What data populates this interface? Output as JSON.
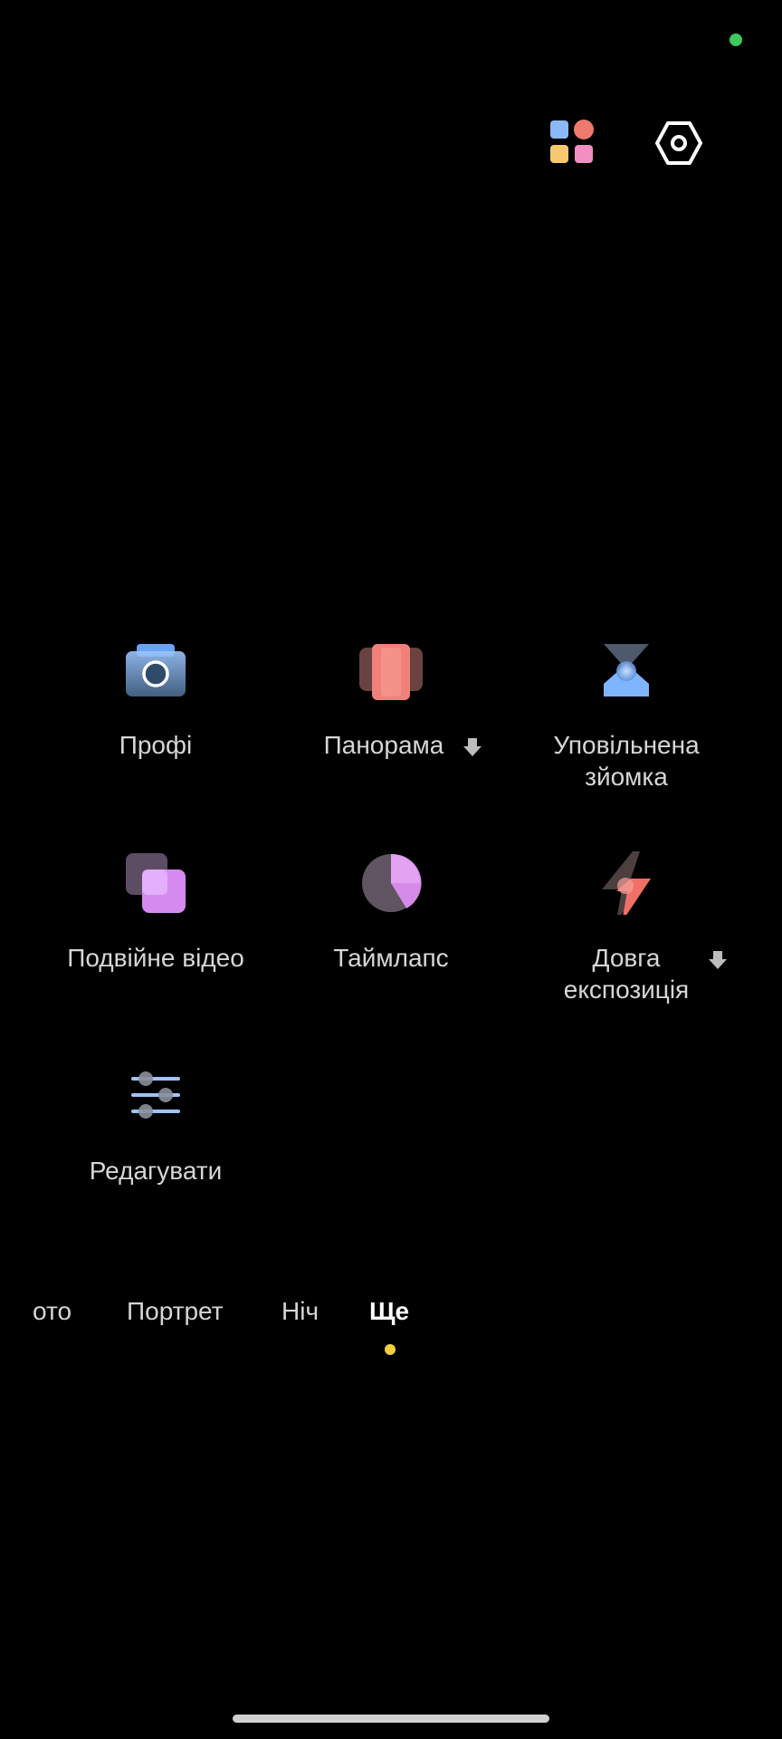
{
  "status": {
    "indicator_color": "#3ec95c"
  },
  "toolbar": {
    "apps_icon": "grid-apps-icon",
    "settings_icon": "settings-hexagon-icon"
  },
  "modes": [
    {
      "label": "Профі",
      "icon": "pro-camera-icon",
      "downloadable": false
    },
    {
      "label": "Панорама",
      "icon": "panorama-icon",
      "downloadable": true
    },
    {
      "label": "Уповільнена\nзйомка",
      "icon": "slow-motion-icon",
      "downloadable": false
    },
    {
      "label": "Подвійне відео",
      "icon": "dual-video-icon",
      "downloadable": false
    },
    {
      "label": "Таймлапс",
      "icon": "timelapse-icon",
      "downloadable": false
    },
    {
      "label": "Довга\nекспозиція",
      "icon": "long-exposure-icon",
      "downloadable": true
    },
    {
      "label": "Редагувати",
      "icon": "edit-sliders-icon",
      "downloadable": false
    }
  ],
  "mode_bar": {
    "tabs": [
      "ото",
      "Портрет",
      "Ніч",
      "Ще"
    ],
    "active_index": 3,
    "active_dot_color": "#f5d03b"
  },
  "colors": {
    "background": "#000000",
    "text": "#d6d6d6",
    "active_text": "#ffffff"
  }
}
